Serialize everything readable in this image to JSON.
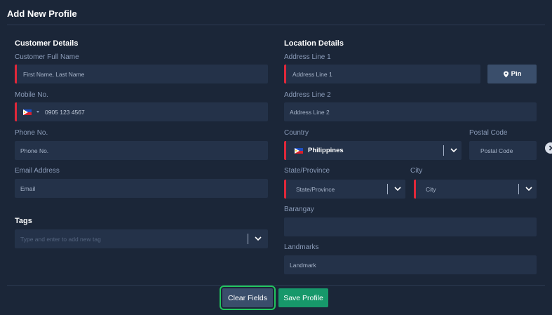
{
  "header": {
    "title": "Add New Profile"
  },
  "customer": {
    "section_title": "Customer Details",
    "full_name": {
      "label": "Customer Full Name",
      "placeholder": "First Name, Last Name"
    },
    "mobile": {
      "label": "Mobile No.",
      "value": "0905 123 4567"
    },
    "phone": {
      "label": "Phone No.",
      "placeholder": "Phone No."
    },
    "email": {
      "label": "Email Address",
      "placeholder": "Email"
    }
  },
  "tags": {
    "section_title": "Tags",
    "placeholder": "Type and enter to add new tag"
  },
  "location": {
    "section_title": "Location Details",
    "address1": {
      "label": "Address Line 1",
      "placeholder": "Address Line 1"
    },
    "pin_label": "Pin",
    "address2": {
      "label": "Address Line 2",
      "placeholder": "Address Line 2"
    },
    "country": {
      "label": "Country",
      "value": "Philippines"
    },
    "postal": {
      "label": "Postal Code",
      "placeholder": "Postal Code"
    },
    "state": {
      "label": "State/Province",
      "placeholder": "State/Province"
    },
    "city": {
      "label": "City",
      "placeholder": "City"
    },
    "barangay": {
      "label": "Barangay",
      "placeholder": ""
    },
    "landmarks": {
      "label": "Landmarks",
      "placeholder": "Landmark"
    }
  },
  "actions": {
    "clear_label": "Clear Fields",
    "save_label": "Save Profile"
  },
  "colors": {
    "background": "#1b2638",
    "field": "#243249",
    "required_marker": "#e0283a",
    "save_button": "#17986a",
    "focus_outline": "#22c55e"
  },
  "icons": {
    "pin": "map-pin-icon",
    "dropdown": "chevron-down-icon",
    "side": "chevron-right-icon",
    "flag": "philippines-flag-icon"
  }
}
